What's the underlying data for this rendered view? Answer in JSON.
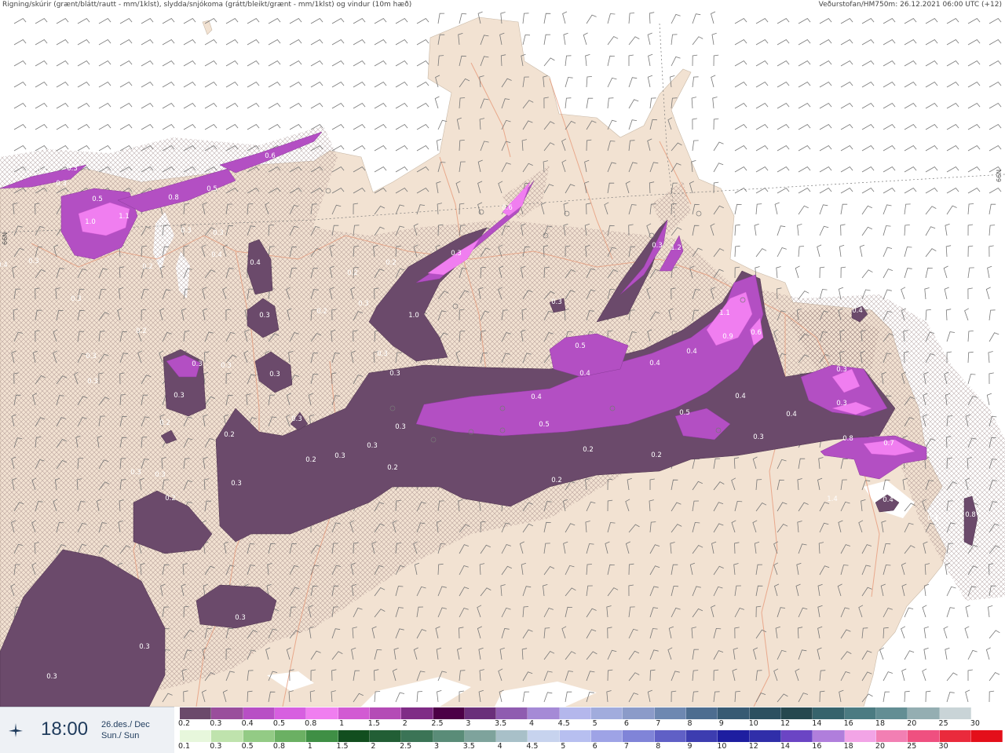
{
  "header": {
    "left_text": "Rigning/skúrir (grænt/blátt/rautt - mm/1klst), slydda/snjókoma (grátt/bleikt/grænt - mm/1klst) og vindur (10m hæð)",
    "right_text": "Veðurstofan/HM750m: 26.12.2021 06:00 UTC (+12)"
  },
  "map": {
    "lat_labels": [
      "66N",
      "66N"
    ],
    "colors": {
      "sea": "#ffffff",
      "land": "#f2e2d2",
      "roads": "#e69a7a",
      "snow_dark": "#6b4a6b",
      "snow_mid": "#b34fc3",
      "snow_light": "#f07ef0"
    },
    "precip_labels": [
      "0.4",
      "0.3",
      "0.3",
      "0.5",
      "1.1",
      "1.0",
      "0.8",
      "0.5",
      "0.6",
      "0.3",
      "0.3",
      "0.4",
      "0.2",
      "0.4",
      "0.3",
      "0.2",
      "0.3",
      "0.3",
      "0.2",
      "0.3",
      "0.3",
      "0.3",
      "0.2",
      "0.3",
      "0.3",
      "0.2",
      "0.3",
      "0.2",
      "0.2",
      "0.3",
      "0.3",
      "0.3",
      "0.3",
      "0.3",
      "0.3",
      "0.3",
      "0.2",
      "0.2",
      "0.2",
      "0.3",
      "0.3",
      "0.2",
      "0.2",
      "0.3",
      "0.3",
      "0.3",
      "0.3",
      "0.6",
      "1.0",
      "0.3",
      "0.3",
      "1.2",
      "0.5",
      "0.4",
      "0.4",
      "0.4",
      "0.5",
      "0.4",
      "1.1",
      "0.9",
      "0.6",
      "0.5",
      "0.4",
      "0.4",
      "0.2",
      "0.3",
      "0.4",
      "0.4",
      "0.3",
      "0.3",
      "0.8",
      "0.7",
      "0.8",
      "1.4",
      "0.3",
      "0.4",
      "0.3"
    ]
  },
  "clock": {
    "time": "18:00",
    "date_is": "26.des./ Dec",
    "day": "Sun./ Sun",
    "icon": "airplane-icon"
  },
  "legend_snow": {
    "ticks": [
      "0.2",
      "0.3",
      "0.4",
      "0.5",
      "0.8",
      "1",
      "1.5",
      "2",
      "2.5",
      "3",
      "3.5",
      "4",
      "4.5",
      "5",
      "6",
      "7",
      "8",
      "9",
      "10",
      "12",
      "14",
      "16",
      "18",
      "20",
      "25",
      "30"
    ],
    "colors": [
      "#6b4a6b",
      "#9a4e9c",
      "#b84fc5",
      "#d75fe0",
      "#f07ef0",
      "#d25ad3",
      "#b44bb6",
      "#7f2c86",
      "#4c0046",
      "#6a2f7a",
      "#8f5cb0",
      "#a58ad6",
      "#b4b7ec",
      "#a1acdd",
      "#8b9bc9",
      "#6e88b1",
      "#4d6d90",
      "#375a73",
      "#2c5060",
      "#26484f",
      "#36636c",
      "#4b7b82",
      "#638e94",
      "#94aeb2",
      "#c9d4d7",
      "#ffffff"
    ]
  },
  "legend_rain": {
    "ticks": [
      "0.1",
      "0.3",
      "0.5",
      "0.8",
      "1",
      "1.5",
      "2",
      "2.5",
      "3",
      "3.5",
      "4",
      "4.5",
      "5",
      "6",
      "7",
      "8",
      "9",
      "10",
      "12",
      "14",
      "16",
      "18",
      "20",
      "25",
      "30"
    ],
    "colors": [
      "#e7f7dc",
      "#bfe3ad",
      "#93cb85",
      "#6bb063",
      "#3f8f45",
      "#124e1f",
      "#225e35",
      "#3b7456",
      "#5a8c78",
      "#7ea39c",
      "#a8c0c8",
      "#c7d3ee",
      "#b7bff0",
      "#9ea3e6",
      "#8084d8",
      "#6060c6",
      "#3d3db0",
      "#1e1ea0",
      "#302ea9",
      "#6b45c4",
      "#b07edc",
      "#f2a4e6",
      "#f27fb3",
      "#ef5080",
      "#ea2a3c",
      "#e40f1a"
    ]
  }
}
